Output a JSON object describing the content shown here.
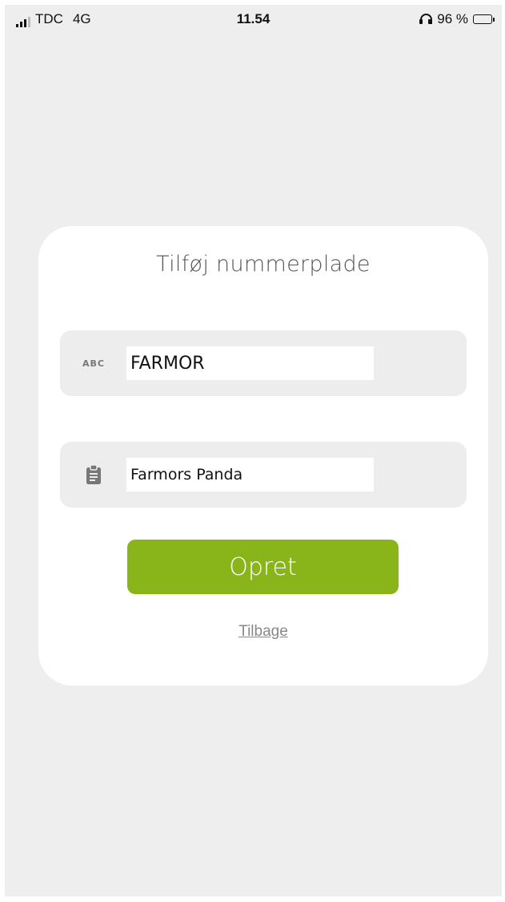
{
  "status_bar": {
    "carrier": "TDC",
    "network": "4G",
    "time": "11.54",
    "battery_text": "96 %",
    "icons": [
      "signal-icon",
      "headphone-icon",
      "battery-icon"
    ]
  },
  "card": {
    "title": "Tilføj nummerplade",
    "plate_field": {
      "icon_label": "ABC",
      "value": "FARMOR"
    },
    "description_field": {
      "icon": "clipboard-icon",
      "value": "Farmors Panda"
    },
    "create_button_label": "Opret",
    "back_link_label": "Tilbage"
  },
  "colors": {
    "accent": "#8ab51a",
    "background": "#eeeeee",
    "card": "#ffffff",
    "field_background": "#ededed"
  }
}
